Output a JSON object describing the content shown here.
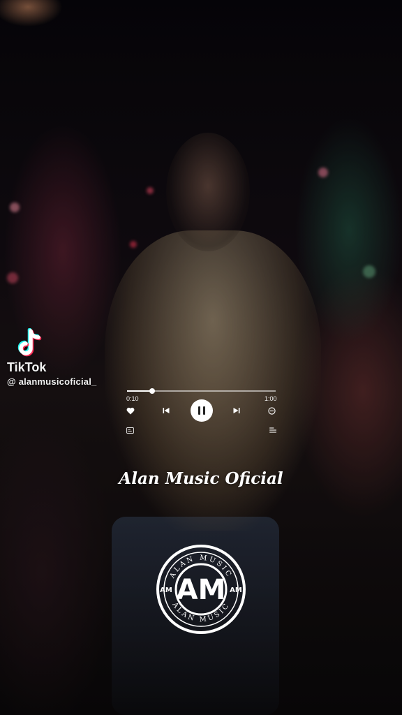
{
  "watermark": {
    "brand": "TikTok",
    "handle": "@ alanmusicoficial_"
  },
  "player": {
    "current_time": "0:10",
    "total_time": "1:00",
    "progress": 0.17
  },
  "song_title": "Alan Music Oficial",
  "logo": {
    "monogram": "AM",
    "ring_text": "ALAN MUSIC",
    "side_marks": "AM"
  },
  "colors": {
    "text": "#ffffff",
    "tiktok_cyan": "#25F4EE",
    "tiktok_red": "#FE2C55"
  },
  "icons": [
    "tiktok-logo-icon",
    "heart-icon",
    "previous-icon",
    "pause-icon",
    "next-icon",
    "minus-circle-icon",
    "lyrics-icon",
    "playlist-icon"
  ]
}
